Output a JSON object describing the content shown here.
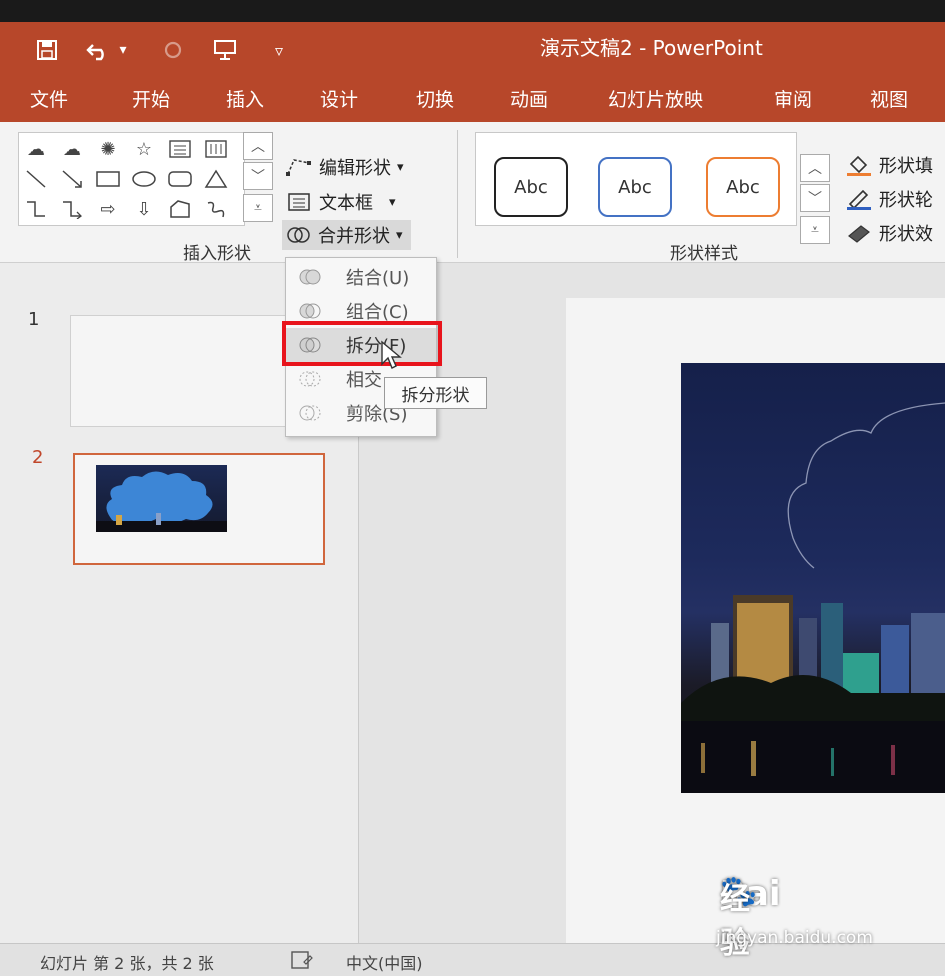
{
  "window": {
    "title": "演示文稿2 - PowerPoint"
  },
  "quick_access": {
    "undo_arrow": "▾",
    "customize": "▿"
  },
  "tabs": [
    "文件",
    "开始",
    "插入",
    "设计",
    "切换",
    "动画",
    "幻灯片放映",
    "审阅",
    "视图"
  ],
  "ribbon": {
    "insert_shapes": {
      "group_label": "插入形状",
      "edit_shape": "编辑形状",
      "text_box": "文本框",
      "merge_shapes": "合并形状",
      "dropdown_arrow": "▾"
    },
    "shape_styles": {
      "group_label": "形状样式",
      "sample_label": "Abc",
      "fill": "形状填",
      "outline": "形状轮",
      "effects": "形状效"
    }
  },
  "merge_menu": {
    "items": [
      {
        "label": "结合(U)"
      },
      {
        "label": "组合(C)"
      },
      {
        "label": "拆分(F)"
      },
      {
        "label": "相交"
      },
      {
        "label": "剪除(S)"
      }
    ],
    "highlighted_index": 2,
    "tooltip": "拆分形状"
  },
  "slides": {
    "numbers": [
      "1",
      "2"
    ],
    "selected": "2"
  },
  "status_bar": {
    "slide_info": "幻灯片 第 2 张，共 2 张",
    "language": "中文(中国)"
  },
  "watermark": {
    "brand": "Bai",
    "brand2": "经验",
    "url": "jingyan.baidu.com"
  },
  "colors": {
    "accent": "#b7472a",
    "highlight": "#e8141c",
    "thumb_border": "#d0663d"
  }
}
